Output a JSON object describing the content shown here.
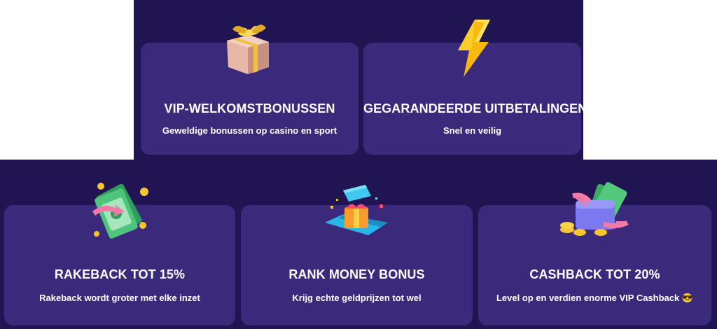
{
  "colors": {
    "page_background": "#211452",
    "card_background": "#3b2a7c",
    "text": "#ffffff"
  },
  "cards": [
    {
      "title": "VIP-WELKOMSTBONUSSEN",
      "subtitle": "Geweldige bonussen op casino en sport",
      "icon": "gift-box-icon"
    },
    {
      "title": "GEGARANDEERDE UITBETALINGEN",
      "subtitle": "Snel en veilig",
      "icon": "lightning-bolt-icon"
    },
    {
      "title": "RAKEBACK TOT 15%",
      "subtitle": "Rakeback wordt groter met elke inzet",
      "icon": "money-stack-icon"
    },
    {
      "title": "RANK MONEY BONUS",
      "subtitle": "Krijg echte geldprijzen tot wel",
      "icon": "open-gift-icon"
    },
    {
      "title": "CASHBACK TOT 20%",
      "subtitle": "Level op en verdien enorme VIP Cashback 😎",
      "icon": "cashback-wallet-icon"
    }
  ]
}
